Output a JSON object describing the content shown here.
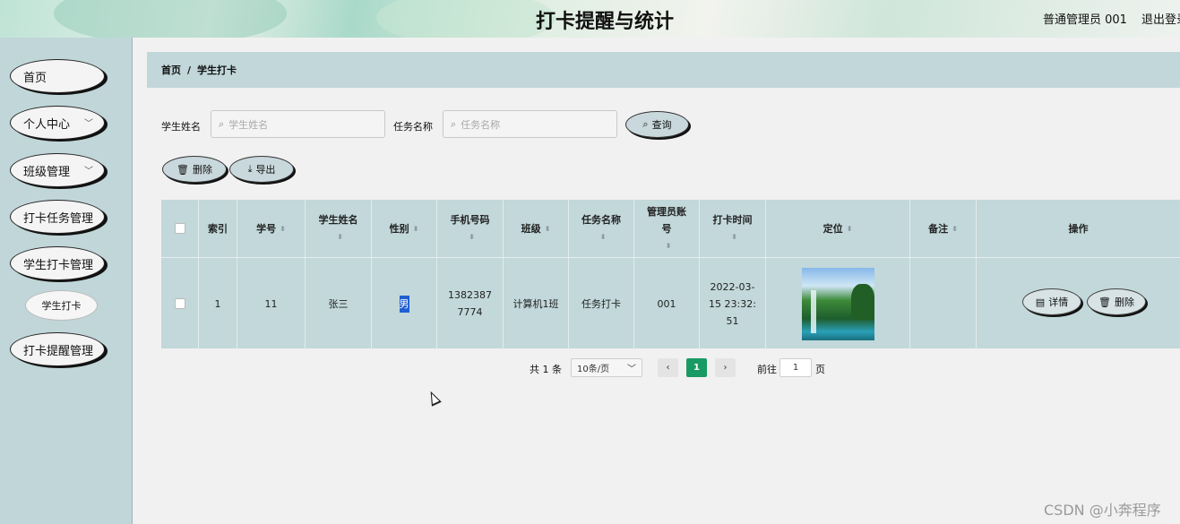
{
  "header": {
    "title": "打卡提醒与统计",
    "user": "普通管理员 001",
    "logout": "退出登录"
  },
  "sidebar": {
    "items": [
      {
        "label": "首页"
      },
      {
        "label": "个人中心"
      },
      {
        "label": "班级管理"
      },
      {
        "label": "打卡任务管理"
      },
      {
        "label": "学生打卡管理"
      },
      {
        "label": "打卡提醒管理"
      }
    ],
    "sub_item": "学生打卡"
  },
  "breadcrumb": {
    "home": "首页",
    "sep": "/",
    "current": "学生打卡"
  },
  "search": {
    "name_label": "学生姓名",
    "name_placeholder": "学生姓名",
    "task_label": "任务名称",
    "task_placeholder": "任务名称",
    "query_button": "查询"
  },
  "toolbar": {
    "delete_label": "删除",
    "export_label": "导出"
  },
  "table": {
    "headers": [
      "索引",
      "学号",
      "学生姓名",
      "性别",
      "手机号码",
      "班级",
      "任务名称",
      "管理员账号",
      "打卡时间",
      "定位",
      "备注",
      "操作"
    ],
    "rows": [
      {
        "index": "1",
        "student_no": "11",
        "name": "张三",
        "gender": "男",
        "phone": "13823877774",
        "class": "计算机1班",
        "task": "任务打卡",
        "admin": "001",
        "time": "2022-03-15 23:32:51",
        "note": "",
        "detail_label": "详情",
        "delete_label": "删除"
      }
    ]
  },
  "pagination": {
    "total": "共 1 条",
    "page_size": "10条/页",
    "current_page": "1",
    "goto_label": "前往",
    "goto_value": "1",
    "page_unit": "页"
  },
  "watermark": "CSDN @小奔程序"
}
